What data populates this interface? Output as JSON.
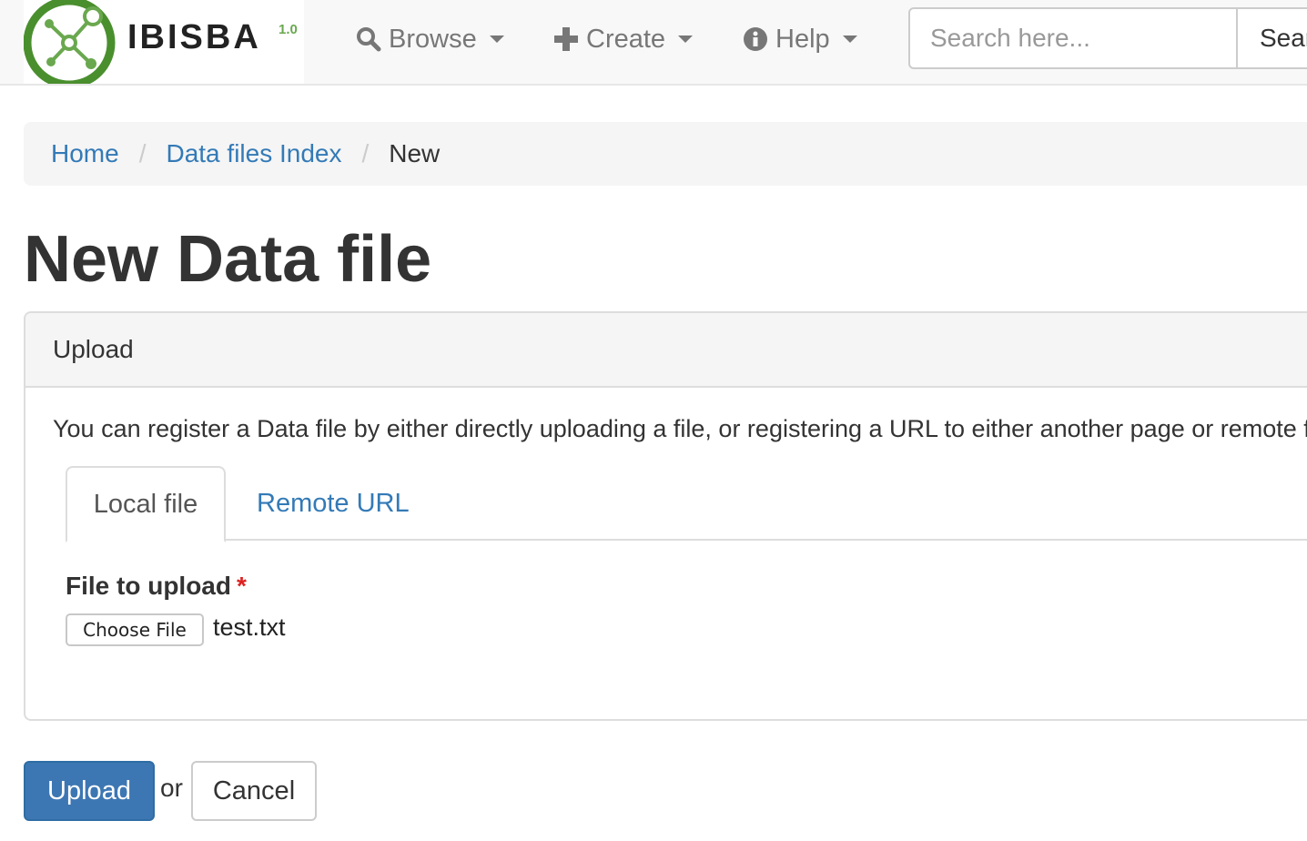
{
  "navbar": {
    "brand_text": "IBISBA",
    "brand_version": "1.0",
    "menus": [
      {
        "label": "Browse",
        "icon": "search-icon"
      },
      {
        "label": "Create",
        "icon": "plus-icon"
      },
      {
        "label": "Help",
        "icon": "info-circle-icon"
      }
    ],
    "search_placeholder": "Search here...",
    "search_button_label": "Search"
  },
  "breadcrumb": {
    "items": [
      "Home",
      "Data files Index"
    ],
    "active": "New"
  },
  "page_title": "New Data file",
  "panel": {
    "heading": "Upload",
    "intro": "You can register a Data file by either directly uploading a file, or registering a URL to either another page or remote file.",
    "tabs": [
      {
        "label": "Local file",
        "active": true
      },
      {
        "label": "Remote URL",
        "active": false
      }
    ],
    "field_label": "File to upload",
    "required_marker": "*",
    "choose_file_label": "Choose File",
    "file_name": "test.txt"
  },
  "actions": {
    "upload_label": "Upload",
    "or_text": "or",
    "cancel_label": "Cancel"
  },
  "colors": {
    "link": "#337ab7",
    "primary": "#3d77b3",
    "required": "#dd2222",
    "logo_green": "#6aa84f"
  }
}
